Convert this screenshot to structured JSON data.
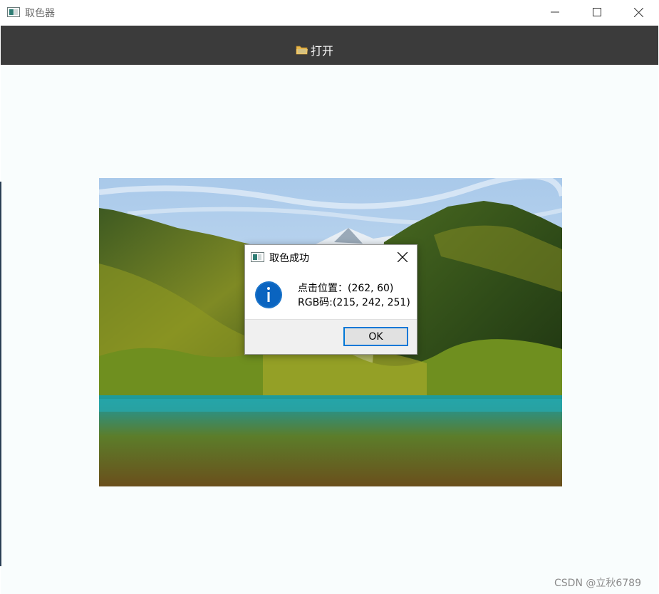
{
  "window": {
    "title": "取色器",
    "icons": {
      "app": "app-window-icon",
      "minimize": "minimize-icon",
      "maximize": "maximize-icon",
      "close": "close-icon"
    }
  },
  "toolbar": {
    "open_label": "打开",
    "open_icon": "folder-icon"
  },
  "dialog": {
    "title": "取色成功",
    "icon": "info-icon",
    "line1": "点击位置：(262, 60)",
    "line2": "RGB码:(215, 242, 251)",
    "ok_label": "OK"
  },
  "watermark": "CSDN @立秋6789",
  "colors": {
    "toolbar_bg": "#3b3b3b",
    "content_bg": "#f9fdfd",
    "accent": "#0078d7",
    "picked_color": "#d7f2fb"
  }
}
